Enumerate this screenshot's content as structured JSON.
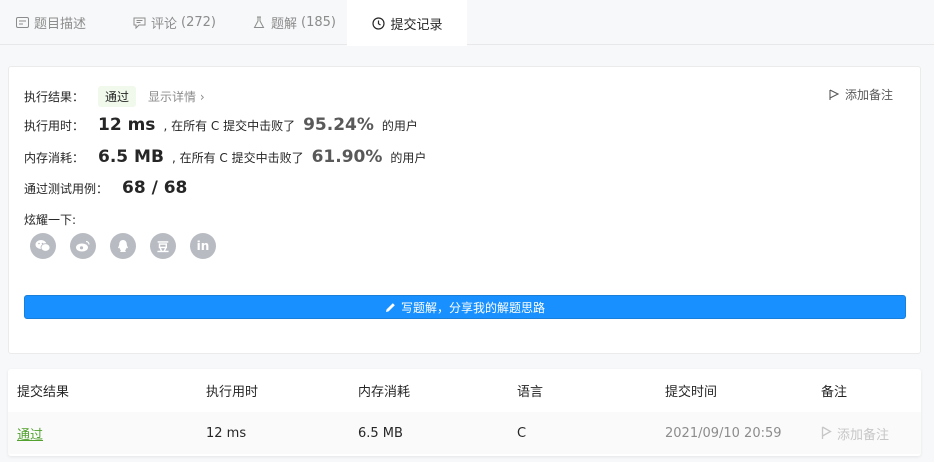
{
  "tabs": [
    {
      "label": "题目描述",
      "count": "",
      "icon": "description-icon"
    },
    {
      "label": "评论",
      "count": "(272)",
      "icon": "comment-icon"
    },
    {
      "label": "题解",
      "count": "(185)",
      "icon": "flask-icon"
    },
    {
      "label": "提交记录",
      "count": "",
      "icon": "clock-icon",
      "active": true
    }
  ],
  "result": {
    "label": "执行结果：",
    "status": "通过",
    "detail_link": "显示详情",
    "detail_chevron": "›",
    "add_note": "添加备注",
    "runtime_label": "执行用时：",
    "runtime_value": "12 ms",
    "runtime_mid": ", 在所有 C 提交中击败了",
    "runtime_pct": "95.24%",
    "runtime_tail": "的用户",
    "memory_label": "内存消耗：",
    "memory_value": "6.5 MB",
    "memory_mid": ", 在所有 C 提交中击败了",
    "memory_pct": "61.90%",
    "memory_tail": "的用户",
    "tests_label": "通过测试用例：",
    "tests_value": "68 / 68",
    "share_label": "炫耀一下:",
    "share_icons": [
      "wechat-icon",
      "weibo-icon",
      "qq-icon",
      "douban-icon",
      "linkedin-icon"
    ],
    "douban_glyph": "豆",
    "linkedin_glyph": "in",
    "write_button": "写题解，分享我的解题思路"
  },
  "table": {
    "headers": [
      "提交结果",
      "执行用时",
      "内存消耗",
      "语言",
      "提交时间",
      "备注"
    ],
    "rows": [
      {
        "status": "通过",
        "runtime": "12 ms",
        "memory": "6.5 MB",
        "language": "C",
        "time": "2021/09/10 20:59",
        "note": "添加备注"
      }
    ]
  },
  "colors": {
    "accent": "#1890ff",
    "success": "#52a12e",
    "muted": "#8c8c8c"
  }
}
